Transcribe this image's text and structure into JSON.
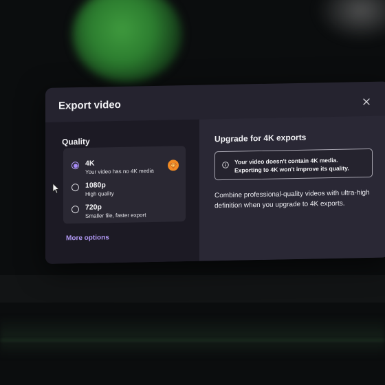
{
  "dialog": {
    "title": "Export video",
    "close_icon": "close-icon"
  },
  "quality": {
    "title": "Quality",
    "options": [
      {
        "label": "4K",
        "description": "Your video has no 4K media",
        "selected": true,
        "premium": true
      },
      {
        "label": "1080p",
        "description": "High quality",
        "selected": false,
        "premium": false
      },
      {
        "label": "720p",
        "description": "Smaller file, faster export",
        "selected": false,
        "premium": false
      }
    ],
    "more_options": "More options"
  },
  "upgrade": {
    "title": "Upgrade for 4K exports",
    "info_line_1": "Your video doesn't contain 4K media.",
    "info_line_2": "Exporting to 4K won't improve its quality.",
    "promo_text": "Combine professional-quality videos with ultra-high definition when you upgrade to 4K exports."
  },
  "colors": {
    "accent": "#a78bfa",
    "premium_badge": "#f08a24",
    "dialog_bg": "#25232f"
  }
}
